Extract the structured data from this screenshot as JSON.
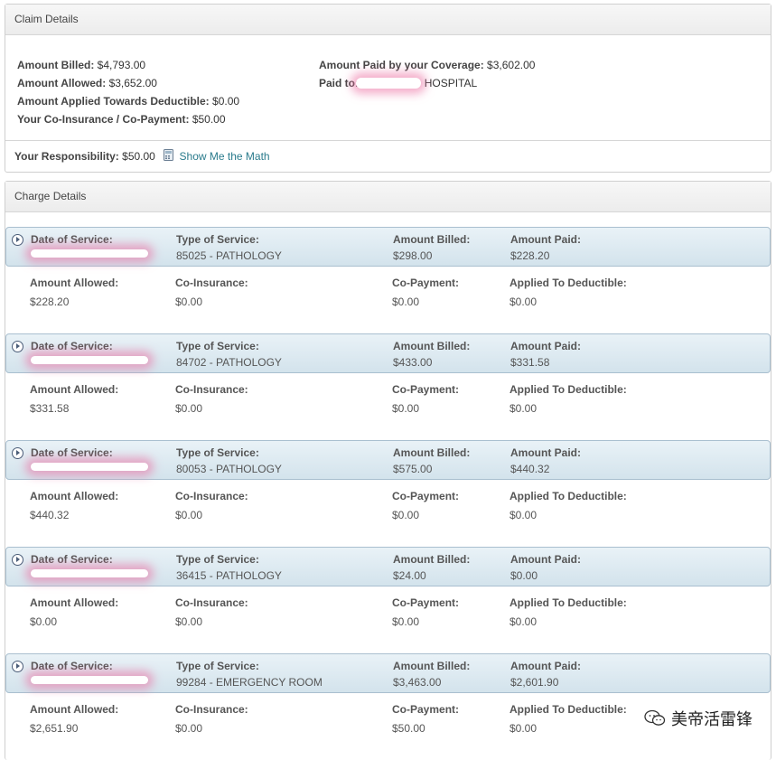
{
  "claim": {
    "title": "Claim Details",
    "amount_billed_label": "Amount Billed:",
    "amount_billed": "$4,793.00",
    "amount_allowed_label": "Amount Allowed:",
    "amount_allowed": "$3,652.00",
    "deductible_label": "Amount Applied Towards Deductible:",
    "deductible": "$0.00",
    "coins_label": "Your Co-Insurance / Co-Payment:",
    "coins": "$50.00",
    "paid_label": "Amount Paid by your Coverage:",
    "paid": "$3,602.00",
    "paid_to_label": "Paid to:",
    "paid_to": "HOSPITAL",
    "responsibility_label": "Your Responsibility:",
    "responsibility": "$50.00",
    "math_link": "Show Me the Math"
  },
  "charges_title": "Charge Details",
  "labels": {
    "date": "Date of Service:",
    "type": "Type of Service:",
    "billed": "Amount Billed:",
    "paid": "Amount Paid:",
    "allowed": "Amount Allowed:",
    "coins": "Co-Insurance:",
    "copay": "Co-Payment:",
    "deductible": "Applied To Deductible:"
  },
  "charges": [
    {
      "type": "85025 - PATHOLOGY",
      "billed": "$298.00",
      "paid": "$228.20",
      "allowed": "$228.20",
      "coins": "$0.00",
      "copay": "$0.00",
      "deductible": "$0.00"
    },
    {
      "type": "84702 - PATHOLOGY",
      "billed": "$433.00",
      "paid": "$331.58",
      "allowed": "$331.58",
      "coins": "$0.00",
      "copay": "$0.00",
      "deductible": "$0.00"
    },
    {
      "type": "80053 - PATHOLOGY",
      "billed": "$575.00",
      "paid": "$440.32",
      "allowed": "$440.32",
      "coins": "$0.00",
      "copay": "$0.00",
      "deductible": "$0.00"
    },
    {
      "type": "36415 - PATHOLOGY",
      "billed": "$24.00",
      "paid": "$0.00",
      "allowed": "$0.00",
      "coins": "$0.00",
      "copay": "$0.00",
      "deductible": "$0.00"
    },
    {
      "type": "99284 - EMERGENCY ROOM",
      "billed": "$3,463.00",
      "paid": "$2,601.90",
      "allowed": "$2,651.90",
      "coins": "$0.00",
      "copay": "$50.00",
      "deductible": "$0.00"
    }
  ],
  "watermark": "美帝活雷锋",
  "icons": {
    "calculator": "calculator-icon",
    "expand": "expand-circle-icon",
    "wechat": "wechat-icon"
  }
}
